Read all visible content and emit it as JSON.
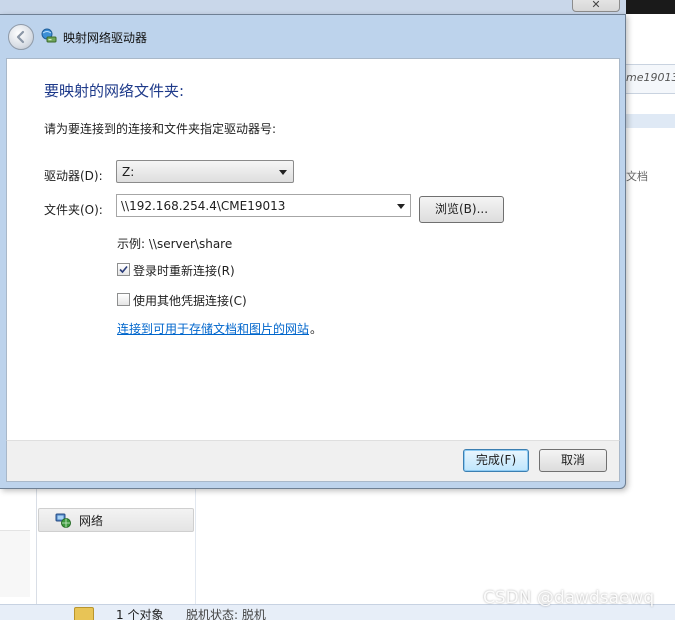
{
  "background_window": {
    "address_text": "me19013",
    "side_text": "文档",
    "nav_item_label": "网络",
    "status_count": "1 个对象",
    "status_state": "脱机状态: 脱机",
    "close_glyph": "✕"
  },
  "watermark": "CSDN @dawdsaewq",
  "dialog": {
    "title": "映射网络驱动器",
    "heading": "要映射的网络文件夹:",
    "instruction": "请为要连接到的连接和文件夹指定驱动器号:",
    "drive_label": "驱动器(D):",
    "drive_value": "Z:",
    "folder_label": "文件夹(O):",
    "folder_value": "\\\\192.168.254.4\\CME19013",
    "browse_label": "浏览(B)...",
    "example_text": "示例: \\\\server\\share",
    "reconnect_label": "登录时重新连接(R)",
    "reconnect_checked": true,
    "credentials_label": "使用其他凭据连接(C)",
    "credentials_checked": false,
    "link_text": "连接到可用于存储文档和图片的网站",
    "link_suffix": "。",
    "finish_label": "完成(F)",
    "cancel_label": "取消"
  },
  "colors": {
    "heading": "#1e3a8a",
    "link": "#0066cc",
    "frame": "#bdd3ec"
  }
}
